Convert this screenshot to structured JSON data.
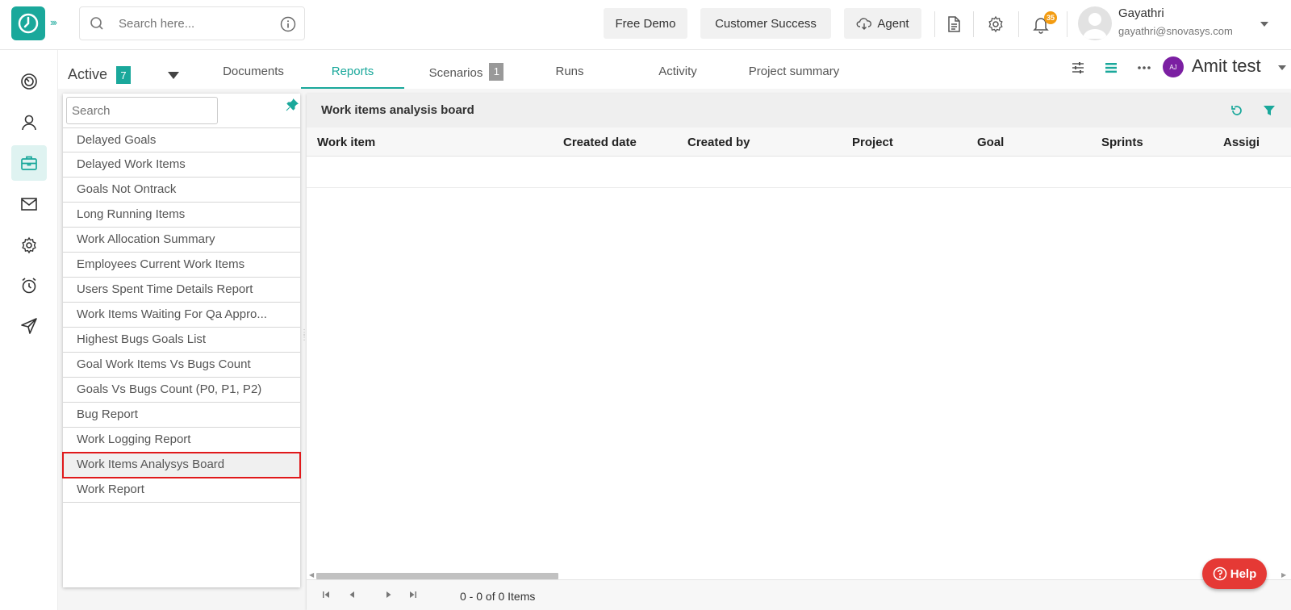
{
  "header": {
    "search_placeholder": "Search here...",
    "free_demo": "Free Demo",
    "customer_success": "Customer Success",
    "agent": "Agent",
    "notification_count": "35",
    "user_name": "Gayathri",
    "user_email": "gayathri@snovasys.com"
  },
  "tabs": {
    "active_label": "Active",
    "active_count": "7",
    "items": [
      {
        "label": "Documents"
      },
      {
        "label": "Reports"
      },
      {
        "label": "Scenarios",
        "badge": "1"
      },
      {
        "label": "Runs"
      },
      {
        "label": "Activity"
      },
      {
        "label": "Project summary"
      }
    ],
    "project_initials": "AJ",
    "project_name": "Amit test"
  },
  "reports": {
    "search_placeholder": "Search",
    "items": [
      "Delayed Goals",
      "Delayed Work Items",
      "Goals Not Ontrack",
      "Long Running Items",
      "Work Allocation Summary",
      "Employees Current Work Items",
      "Users Spent Time Details Report",
      "Work Items Waiting For Qa Appro...",
      "Highest Bugs Goals List",
      "Goal Work Items Vs Bugs Count",
      "Goals Vs Bugs Count (P0, P1, P2)",
      "Bug Report",
      "Work Logging Report",
      "Work Items Analysys Board",
      "Work Report"
    ],
    "selected": "Work Items Analysys Board"
  },
  "board": {
    "title": "Work items analysis board",
    "columns": [
      "Work item",
      "Created date",
      "Created by",
      "Project",
      "Goal",
      "Sprints",
      "Assigi"
    ],
    "pager_text": "0 - 0 of 0 Items"
  },
  "help": {
    "label": "Help"
  },
  "colors": {
    "accent": "#1aa89b",
    "selection_outline": "#e0191b",
    "help": "#e53935",
    "project_avatar": "#7b1fa2"
  }
}
